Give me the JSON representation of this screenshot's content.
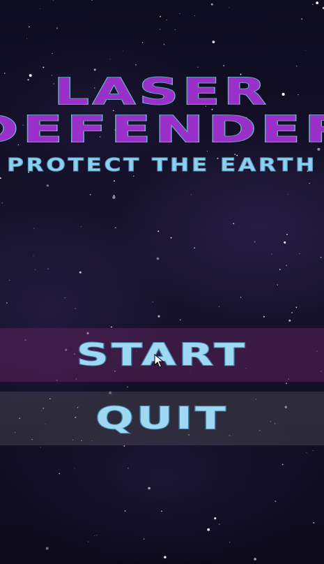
{
  "game": {
    "title_line_1": "LASER",
    "title_line_2": "DEFENDER",
    "subtitle": "PROTECT THE EARTH"
  },
  "menu": {
    "start_label": "START",
    "quit_label": "QUIT"
  },
  "colors": {
    "title_fill": "#9a2fc9",
    "title_outline": "#7fc4e4",
    "button_text": "#9fd8f3",
    "start_highlight": "#5a2058",
    "quit_background": "#5f5f5f",
    "background": "#0d0b1c"
  },
  "icons": {
    "cursor": "mouse-pointer-icon"
  }
}
